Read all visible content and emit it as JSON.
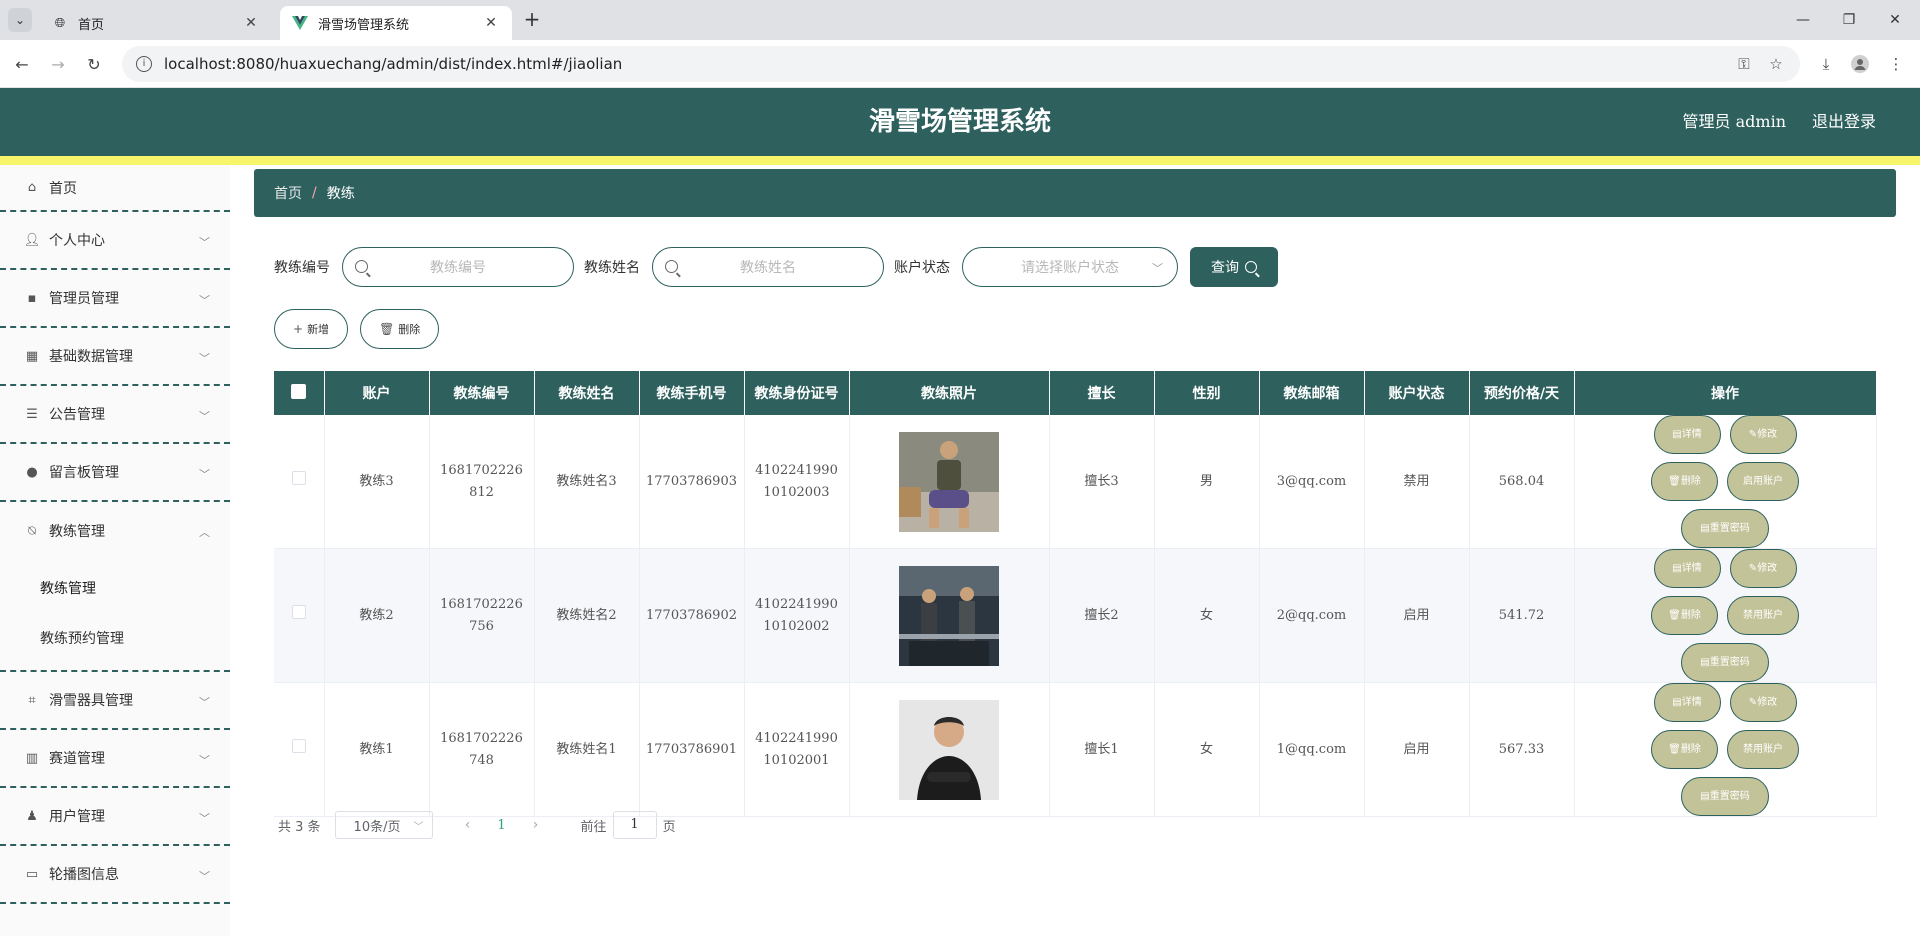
{
  "browser": {
    "tabs": [
      {
        "title": "首页"
      },
      {
        "title": "滑雪场管理系统"
      }
    ],
    "new_tab": "+",
    "url": "localhost:8080/huaxuechang/admin/dist/index.html#/jiaolian"
  },
  "header": {
    "title": "滑雪场管理系统",
    "user": "管理员 admin",
    "logout": "退出登录"
  },
  "sidebar": {
    "items": [
      {
        "label": "首页",
        "icon": "home-icon"
      },
      {
        "label": "个人中心",
        "icon": "user-icon"
      },
      {
        "label": "管理员管理",
        "icon": "chat-icon"
      },
      {
        "label": "基础数据管理",
        "icon": "grid-icon"
      },
      {
        "label": "公告管理",
        "icon": "sliders-icon"
      },
      {
        "label": "留言板管理",
        "icon": "bulb-icon"
      },
      {
        "label": "教练管理",
        "icon": "bell-off-icon"
      },
      {
        "label": "滑雪器具管理",
        "icon": "crop-icon"
      },
      {
        "label": "赛道管理",
        "icon": "chart-icon"
      },
      {
        "label": "用户管理",
        "icon": "person-icon"
      },
      {
        "label": "轮播图信息",
        "icon": "card-icon"
      }
    ],
    "sub_items": [
      {
        "label": "教练管理"
      },
      {
        "label": "教练预约管理"
      }
    ]
  },
  "breadcrumb": {
    "home": "首页",
    "separator": "/",
    "current": "教练"
  },
  "search": {
    "code_label": "教练编号",
    "code_placeholder": "教练编号",
    "name_label": "教练姓名",
    "name_placeholder": "教练姓名",
    "status_label": "账户状态",
    "status_placeholder": "请选择账户状态",
    "query": "查询"
  },
  "actions": {
    "add": "新增",
    "delete": "删除"
  },
  "table": {
    "headers": [
      "账户",
      "教练编号",
      "教练姓名",
      "教练手机号",
      "教练身份证号",
      "教练照片",
      "擅长",
      "性别",
      "教练邮箱",
      "账户状态",
      "预约价格/天",
      "操作"
    ],
    "rows": [
      {
        "account": "教练3",
        "code": "1681702226812",
        "name": "教练姓名3",
        "phone": "17703786903",
        "idcard": "410224199010102003",
        "specialty": "擅长3",
        "gender": "男",
        "email": "3@qq.com",
        "status": "禁用",
        "price": "568.04",
        "toggle": "启用账户"
      },
      {
        "account": "教练2",
        "code": "1681702226756",
        "name": "教练姓名2",
        "phone": "17703786902",
        "idcard": "410224199010102002",
        "specialty": "擅长2",
        "gender": "女",
        "email": "2@qq.com",
        "status": "启用",
        "price": "541.72",
        "toggle": "禁用账户"
      },
      {
        "account": "教练1",
        "code": "1681702226748",
        "name": "教练姓名1",
        "phone": "17703786901",
        "idcard": "410224199010102001",
        "specialty": "擅长1",
        "gender": "女",
        "email": "1@qq.com",
        "status": "启用",
        "price": "567.33",
        "toggle": "禁用账户"
      }
    ],
    "op_labels": {
      "detail": "详情",
      "edit": "修改",
      "delete": "删除",
      "reset": "重置密码"
    }
  },
  "pagination": {
    "total": "共 3 条",
    "page_size": "10条/页",
    "current": "1",
    "goto_prefix": "前往",
    "goto_value": "1",
    "goto_suffix": "页"
  }
}
